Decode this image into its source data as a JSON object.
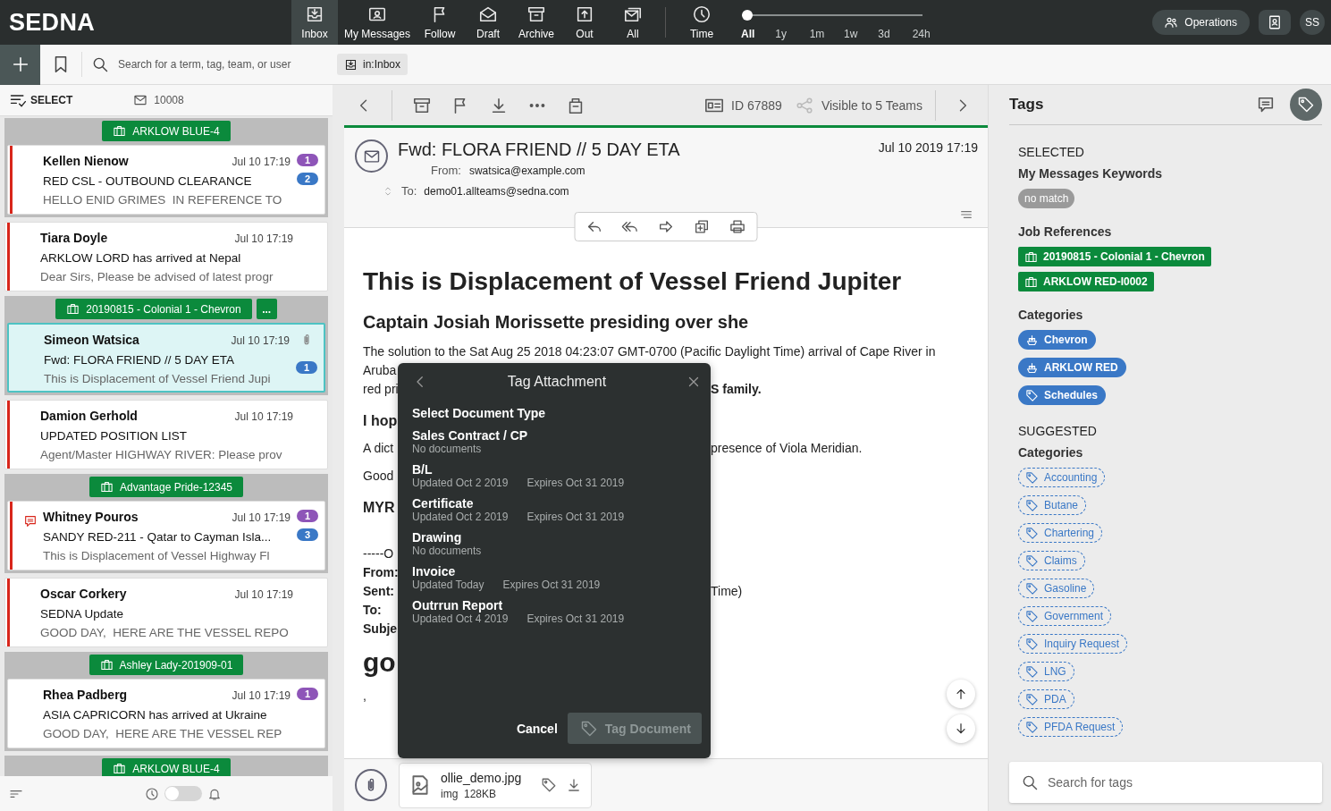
{
  "app": {
    "logo": "SEDNA"
  },
  "nav": [
    {
      "label": "Inbox",
      "selected": true
    },
    {
      "label": "My Messages",
      "selected": false
    },
    {
      "label": "Follow",
      "selected": false
    },
    {
      "label": "Draft",
      "selected": false
    },
    {
      "label": "Archive",
      "selected": false
    },
    {
      "label": "Out",
      "selected": false
    },
    {
      "label": "All",
      "selected": false
    }
  ],
  "time_filter": {
    "label": "Time",
    "level": 0,
    "options": [
      {
        "label": "All",
        "selected": true
      },
      {
        "label": "1y",
        "selected": false
      },
      {
        "label": "1m",
        "selected": false
      },
      {
        "label": "1w",
        "selected": false
      },
      {
        "label": "3d",
        "selected": false
      },
      {
        "label": "24h",
        "selected": false
      }
    ]
  },
  "header_right": {
    "operations": "Operations",
    "initials": "SS"
  },
  "search_bar": {
    "placeholder": "Search for a term, tag, team, or user",
    "filter_chip": "in:Inbox"
  },
  "message_list": {
    "select_label": "SELECT",
    "count": "10008",
    "toggle_on": false,
    "threads": [
      {
        "kind": "group",
        "job_refs": [
          "ARKLOW BLUE-4"
        ],
        "messages": [
          {
            "sender": "Kellen Nienow",
            "time": "Jul 10 17:19",
            "subject": "RED CSL - OUTBOUND CLEARANCE",
            "preview": "HELLO ENID GRIMES  IN REFERENCE TO",
            "unread": true,
            "selected": false,
            "attachment": false,
            "comment": false,
            "badges": [
              {
                "count": "1",
                "color": "#8e55b8"
              },
              {
                "count": "2",
                "color": "#3a78c6"
              }
            ]
          }
        ]
      },
      {
        "kind": "single",
        "messages": [
          {
            "sender": "Tiara Doyle",
            "time": "Jul 10 17:19",
            "subject": "ARKLOW LORD has arrived at Nepal",
            "preview": "Dear Sirs, Please be advised of latest progr",
            "unread": true,
            "selected": false,
            "attachment": false,
            "comment": false
          }
        ]
      },
      {
        "kind": "group",
        "job_refs": [
          "20190815 - Colonial 1 - Chevron"
        ],
        "more": "...",
        "messages": [
          {
            "sender": "Simeon Watsica",
            "time": "Jul 10 17:19",
            "subject": "Fwd: FLORA FRIEND // 5 DAY ETA",
            "preview": "This is Displacement of Vessel Friend Jupi",
            "unread": false,
            "selected": true,
            "attachment": true,
            "comment": false,
            "badges": [
              {
                "count": "1",
                "color": "#3a78c6"
              }
            ]
          }
        ]
      },
      {
        "kind": "single",
        "messages": [
          {
            "sender": "Damion Gerhold",
            "time": "Jul 10 17:19",
            "subject": "UPDATED POSITION LIST",
            "preview": "Agent/Master HIGHWAY RIVER: Please prov",
            "unread": true,
            "selected": false,
            "attachment": false,
            "comment": false
          }
        ]
      },
      {
        "kind": "group",
        "job_refs": [
          "Advantage Pride-12345"
        ],
        "messages": [
          {
            "sender": "Whitney Pouros",
            "time": "Jul 10 17:19",
            "subject": "SANDY RED-211 - Qatar to Cayman Isla...",
            "preview": "This is Displacement of Vessel Highway Fl",
            "unread": true,
            "selected": false,
            "attachment": false,
            "comment": true,
            "badges": [
              {
                "count": "1",
                "color": "#8e55b8"
              },
              {
                "count": "3",
                "color": "#3a78c6"
              }
            ]
          }
        ]
      },
      {
        "kind": "single",
        "messages": [
          {
            "sender": "Oscar Corkery",
            "time": "Jul 10 17:19",
            "subject": "SEDNA Update",
            "preview": "GOOD DAY,  HERE ARE THE VESSEL REPO",
            "unread": true,
            "selected": false,
            "attachment": false,
            "comment": false
          }
        ]
      },
      {
        "kind": "group",
        "job_refs": [
          "Ashley Lady-201909-01"
        ],
        "messages": [
          {
            "sender": "Rhea Padberg",
            "time": "Jul 10 17:19",
            "subject": "ASIA CAPRICORN has arrived at Ukraine",
            "preview": "GOOD DAY,  HERE ARE THE VESSEL REP",
            "unread": false,
            "selected": false,
            "attachment": false,
            "comment": false,
            "badges": [
              {
                "count": "1",
                "color": "#8e55b8"
              }
            ]
          }
        ]
      },
      {
        "kind": "group",
        "job_refs": [
          "ARKLOW BLUE-4"
        ]
      }
    ]
  },
  "mail": {
    "id": "ID 67889",
    "visibility": "Visible to 5 Teams",
    "subject": "Fwd: FLORA FRIEND // 5 DAY ETA",
    "date": "Jul 10 2019 17:19",
    "from_label": "From:",
    "from": "swatsica@example.com",
    "to_label": "To:",
    "to": "demo01.allteams@sedna.com",
    "body": {
      "title": "This is Displacement of Vessel Friend Jupiter",
      "subtitle": "Captain Josiah Morissette presiding over she",
      "lines": [
        {
          "kind": "para",
          "left": "The solution to the Sat Aug 25 2018 04:23:07 GMT-0700 (Pacific Daylight Time) arrival of Cape River in"
        },
        {
          "kind": "text",
          "left": "Aruba"
        },
        {
          "kind": "text",
          "left": "red pri",
          "right": "S family.",
          "right_bold": true
        },
        {
          "kind": "heading",
          "left": "I hop"
        },
        {
          "kind": "para",
          "left": "A dict",
          "right": "presence of Viola Meridian.",
          "right_bold": false
        },
        {
          "kind": "para",
          "left": "Good"
        },
        {
          "kind": "heading",
          "left": "MYR"
        },
        {
          "kind": "quote",
          "left": "-----O"
        },
        {
          "kind": "field",
          "left": "From:"
        },
        {
          "kind": "field",
          "left": "Sent:",
          "right": "Time)",
          "right_bold": false
        },
        {
          "kind": "field",
          "left": "To:"
        },
        {
          "kind": "field",
          "left": "Subje"
        },
        {
          "kind": "big",
          "left": "go"
        },
        {
          "kind": "para",
          "left": ","
        }
      ]
    },
    "attachment": {
      "name": "ollie_demo.jpg",
      "type": "img",
      "size": "128KB"
    }
  },
  "tag_modal": {
    "title": "Tag Attachment",
    "heading": "Select Document Type",
    "types": [
      {
        "name": "Sales Contract / CP",
        "status": "No documents"
      },
      {
        "name": "B/L",
        "updated": "Updated Oct 2 2019",
        "expires": "Expires Oct 31 2019"
      },
      {
        "name": "Certificate",
        "updated": "Updated Oct 2 2019",
        "expires": "Expires Oct 31 2019"
      },
      {
        "name": "Drawing",
        "status": "No documents"
      },
      {
        "name": "Invoice",
        "updated": "Updated Today",
        "expires": "Expires Oct 31 2019"
      },
      {
        "name": "Outrrun Report",
        "updated": "Updated Oct 4 2019",
        "expires": "Expires Oct 31 2019"
      }
    ],
    "cancel": "Cancel",
    "confirm": {
      "label": "Tag Document",
      "disabled": true
    }
  },
  "tags_panel": {
    "title": "Tags",
    "sections": [
      {
        "heading": "SELECTED",
        "groups": [
          {
            "title": "My Messages Keywords",
            "tags": [
              {
                "label": "no match",
                "kind": "keyword"
              }
            ]
          },
          {
            "title": "Job References",
            "tags": [
              {
                "label": "20190815 - Colonial 1 - Chevron",
                "kind": "job"
              },
              {
                "label": "ARKLOW RED-I0002",
                "kind": "job"
              }
            ]
          },
          {
            "title": "Categories",
            "tags": [
              {
                "label": "Chevron",
                "kind": "vessel"
              },
              {
                "label": "ARKLOW RED",
                "kind": "vessel"
              },
              {
                "label": "Schedules",
                "kind": "category"
              }
            ]
          }
        ]
      },
      {
        "heading": "SUGGESTED",
        "groups": [
          {
            "title": "Categories",
            "tags": [
              {
                "label": "Accounting",
                "kind": "suggested"
              },
              {
                "label": "Butane",
                "kind": "suggested"
              },
              {
                "label": "Chartering",
                "kind": "suggested"
              },
              {
                "label": "Claims",
                "kind": "suggested"
              },
              {
                "label": "Gasoline",
                "kind": "suggested"
              },
              {
                "label": "Government",
                "kind": "suggested"
              },
              {
                "label": "Inquiry Request",
                "kind": "suggested"
              },
              {
                "label": "LNG",
                "kind": "suggested"
              },
              {
                "label": "PDA",
                "kind": "suggested"
              },
              {
                "label": "PFDA Request",
                "kind": "suggested"
              }
            ]
          }
        ]
      }
    ],
    "search_placeholder": "Search for tags"
  }
}
